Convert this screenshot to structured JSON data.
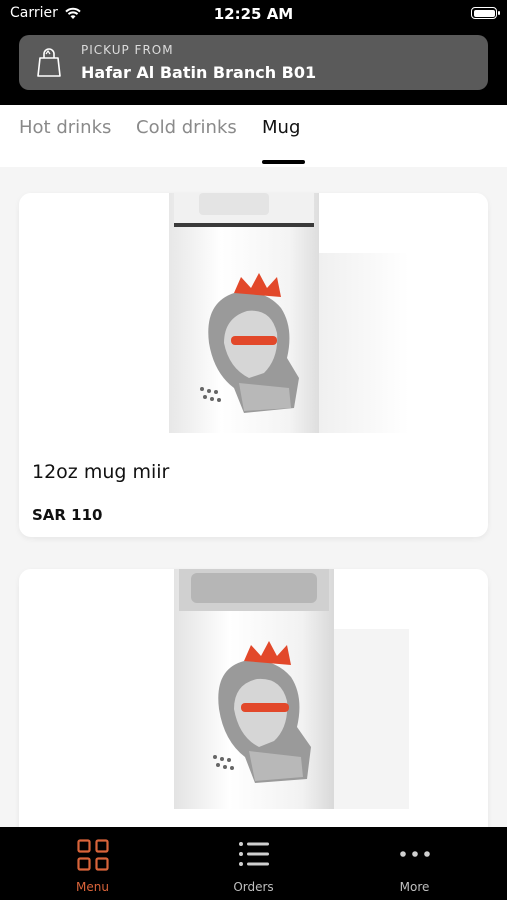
{
  "status_bar": {
    "carrier": "Carrier",
    "time": "12:25 AM"
  },
  "pickup": {
    "label": "PICKUP FROM",
    "branch": "Hafar Al Batin Branch B01"
  },
  "tabs": [
    {
      "label": "Hot drinks",
      "active": false
    },
    {
      "label": "Cold drinks",
      "active": false
    },
    {
      "label": "Mug",
      "active": true
    }
  ],
  "products": [
    {
      "name": "12oz mug miir",
      "price": "SAR 110"
    },
    {
      "name": "",
      "price": ""
    }
  ],
  "bottom_nav": [
    {
      "label": "Menu",
      "icon": "grid-icon",
      "active": true
    },
    {
      "label": "Orders",
      "icon": "list-icon",
      "active": false
    },
    {
      "label": "More",
      "icon": "more-dots-icon",
      "active": false
    }
  ],
  "colors": {
    "accent": "#d9643a",
    "header_bg": "#000000",
    "pickup_bg": "#5a5a5a"
  }
}
